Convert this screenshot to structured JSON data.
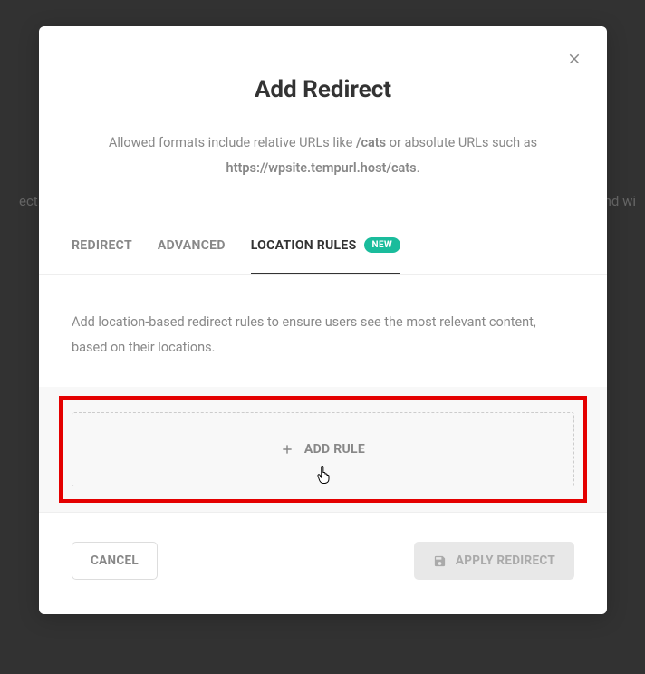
{
  "background": {
    "text_left": "ect tra",
    "text_right": "nd wi"
  },
  "modal": {
    "title": "Add Redirect",
    "subtitle_prefix": "Allowed formats include relative URLs like ",
    "subtitle_example1": "/cats",
    "subtitle_middle": " or absolute URLs such as ",
    "subtitle_example2": "https://wpsite.tempurl.host/cats",
    "subtitle_suffix": "."
  },
  "tabs": {
    "redirect": "REDIRECT",
    "advanced": "ADVANCED",
    "location_rules": "LOCATION RULES",
    "badge": "NEW"
  },
  "content": {
    "description": "Add location-based redirect rules to ensure users see the most relevant content, based on their locations.",
    "add_rule_label": "ADD RULE"
  },
  "footer": {
    "cancel": "CANCEL",
    "apply": "APPLY REDIRECT"
  }
}
